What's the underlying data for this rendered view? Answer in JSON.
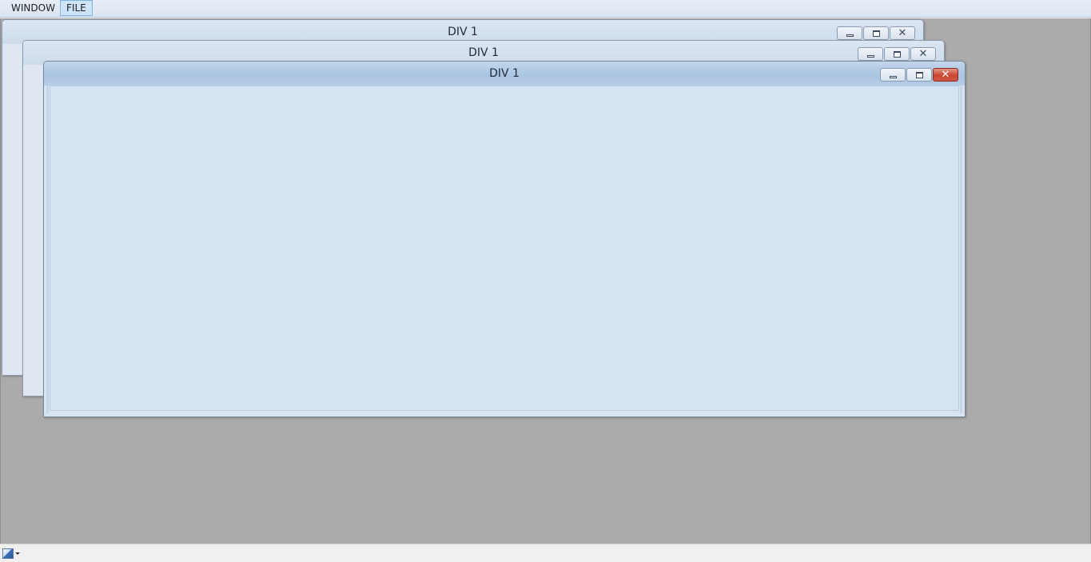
{
  "menubar": {
    "items": [
      {
        "label": "WINDOW",
        "active": false
      },
      {
        "label": "FILE",
        "active": true
      }
    ]
  },
  "windows": [
    {
      "title": "DIV 1",
      "state": "inactive"
    },
    {
      "title": "DIV 1",
      "state": "inactive"
    },
    {
      "title": "DIV 1",
      "state": "active"
    }
  ],
  "colors": {
    "desktop": "#ababab",
    "client": "#d6e4f2",
    "close_active": "#c8452e"
  },
  "statusbar": {
    "icon": "image-icon"
  }
}
